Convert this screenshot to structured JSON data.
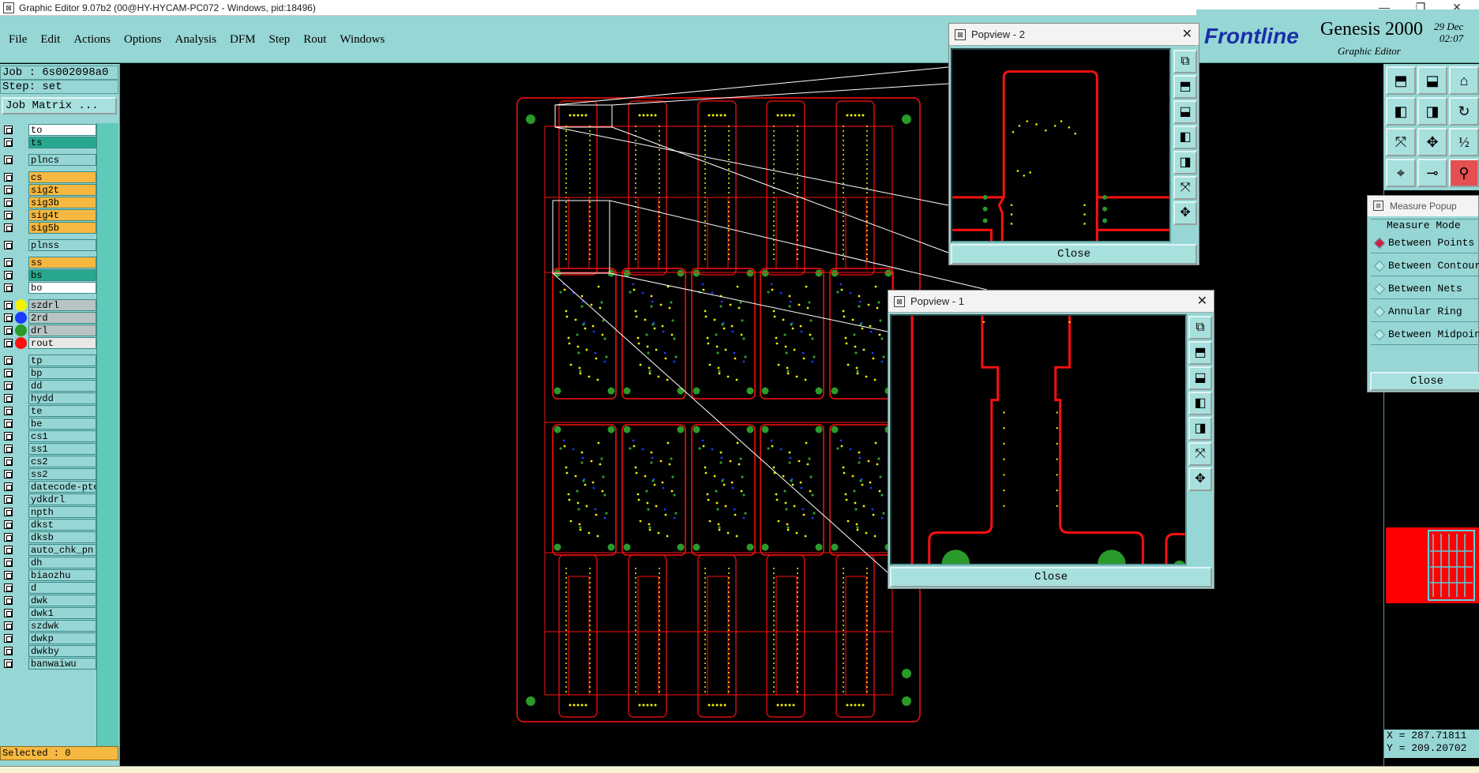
{
  "window": {
    "title": "Graphic Editor 9.07b2 (00@HY-HYCAM-PC072 - Windows, pid:18496)",
    "minimize": "—",
    "restore": "❐",
    "close": "✕"
  },
  "menu": [
    "File",
    "Edit",
    "Actions",
    "Options",
    "Analysis",
    "DFM",
    "Step",
    "Rout",
    "Windows"
  ],
  "logo": {
    "brand": "Frontline",
    "product": "Genesis 2000",
    "subtitle": "Graphic Editor",
    "date_day": "29",
    "date_month": "Dec",
    "time": "02:07"
  },
  "job": {
    "job_line": "Job : 6s002098a0",
    "step_line": "Step: set",
    "matrix_button": "Job Matrix ..."
  },
  "layers": [
    {
      "name": "to",
      "color": "#ffffff",
      "dot": ""
    },
    {
      "name": "ts",
      "color": "#27a88e",
      "dot": ""
    },
    {
      "name": "plncs",
      "color": "#96d6d4",
      "dot": ""
    },
    {
      "name": "cs",
      "color": "#f6b840",
      "dot": ""
    },
    {
      "name": "sig2t",
      "color": "#f6b840",
      "dot": ""
    },
    {
      "name": "sig3b",
      "color": "#f6b840",
      "dot": ""
    },
    {
      "name": "sig4t",
      "color": "#f6b840",
      "dot": ""
    },
    {
      "name": "sig5b",
      "color": "#f6b840",
      "dot": ""
    },
    {
      "name": "plnss",
      "color": "#96d6d4",
      "dot": ""
    },
    {
      "name": "ss",
      "color": "#f6b840",
      "dot": ""
    },
    {
      "name": "bs",
      "color": "#27a88e",
      "dot": ""
    },
    {
      "name": "bo",
      "color": "#ffffff",
      "dot": ""
    },
    {
      "name": "szdrl",
      "color": "#b8c4c4",
      "dot": "#f2f200"
    },
    {
      "name": "2rd",
      "color": "#b8c4c4",
      "dot": "#1a3cff"
    },
    {
      "name": "drl",
      "color": "#b8c4c4",
      "dot": "#2a9a2a"
    },
    {
      "name": "rout",
      "color": "#e8e8e8",
      "dot": "#ff1010"
    },
    {
      "name": "tp",
      "color": "#96d6d4",
      "dot": ""
    },
    {
      "name": "bp",
      "color": "#96d6d4",
      "dot": ""
    },
    {
      "name": "dd",
      "color": "#96d6d4",
      "dot": ""
    },
    {
      "name": "hydd",
      "color": "#96d6d4",
      "dot": ""
    },
    {
      "name": "te",
      "color": "#96d6d4",
      "dot": ""
    },
    {
      "name": "be",
      "color": "#96d6d4",
      "dot": ""
    },
    {
      "name": "cs1",
      "color": "#96d6d4",
      "dot": ""
    },
    {
      "name": "ss1",
      "color": "#96d6d4",
      "dot": ""
    },
    {
      "name": "cs2",
      "color": "#96d6d4",
      "dot": ""
    },
    {
      "name": "ss2",
      "color": "#96d6d4",
      "dot": ""
    },
    {
      "name": "datecode-pte",
      "color": "#96d6d4",
      "dot": ""
    },
    {
      "name": "ydkdrl",
      "color": "#96d6d4",
      "dot": ""
    },
    {
      "name": "npth",
      "color": "#96d6d4",
      "dot": ""
    },
    {
      "name": "dkst",
      "color": "#96d6d4",
      "dot": ""
    },
    {
      "name": "dksb",
      "color": "#96d6d4",
      "dot": ""
    },
    {
      "name": "auto_chk_pn.",
      "color": "#96d6d4",
      "dot": ""
    },
    {
      "name": "dh",
      "color": "#96d6d4",
      "dot": ""
    },
    {
      "name": "biaozhu",
      "color": "#96d6d4",
      "dot": ""
    },
    {
      "name": "d",
      "color": "#96d6d4",
      "dot": ""
    },
    {
      "name": "dwk",
      "color": "#96d6d4",
      "dot": ""
    },
    {
      "name": "dwk1",
      "color": "#96d6d4",
      "dot": ""
    },
    {
      "name": "szdwk",
      "color": "#96d6d4",
      "dot": ""
    },
    {
      "name": "dwkp",
      "color": "#96d6d4",
      "dot": ""
    },
    {
      "name": "dwkby",
      "color": "#96d6d4",
      "dot": ""
    },
    {
      "name": "banwaiwu",
      "color": "#96d6d4",
      "dot": ""
    }
  ],
  "status": {
    "selected": "Selected : 0",
    "coord_x": "X = 287.71811",
    "coord_y": "Y = 209.20702"
  },
  "popview2": {
    "title": "Popview - 2",
    "close": "Close",
    "x_icon": "✕"
  },
  "popview1": {
    "title": "Popview - 1",
    "close": "Close",
    "x_icon": "✕"
  },
  "measure": {
    "title": "Measure Popup",
    "header": "Measure Mode",
    "options": [
      "Between Points",
      "Between Contours",
      "Between Nets",
      "Annular Ring",
      "Between Midpoints"
    ],
    "selected_index": 0,
    "close": "Close"
  },
  "colors": {
    "panel": "#96d6d4",
    "rout": "#ff1010",
    "pad": "#2a9a2a",
    "drill": "#f2f200",
    "via": "#1a3cff"
  }
}
